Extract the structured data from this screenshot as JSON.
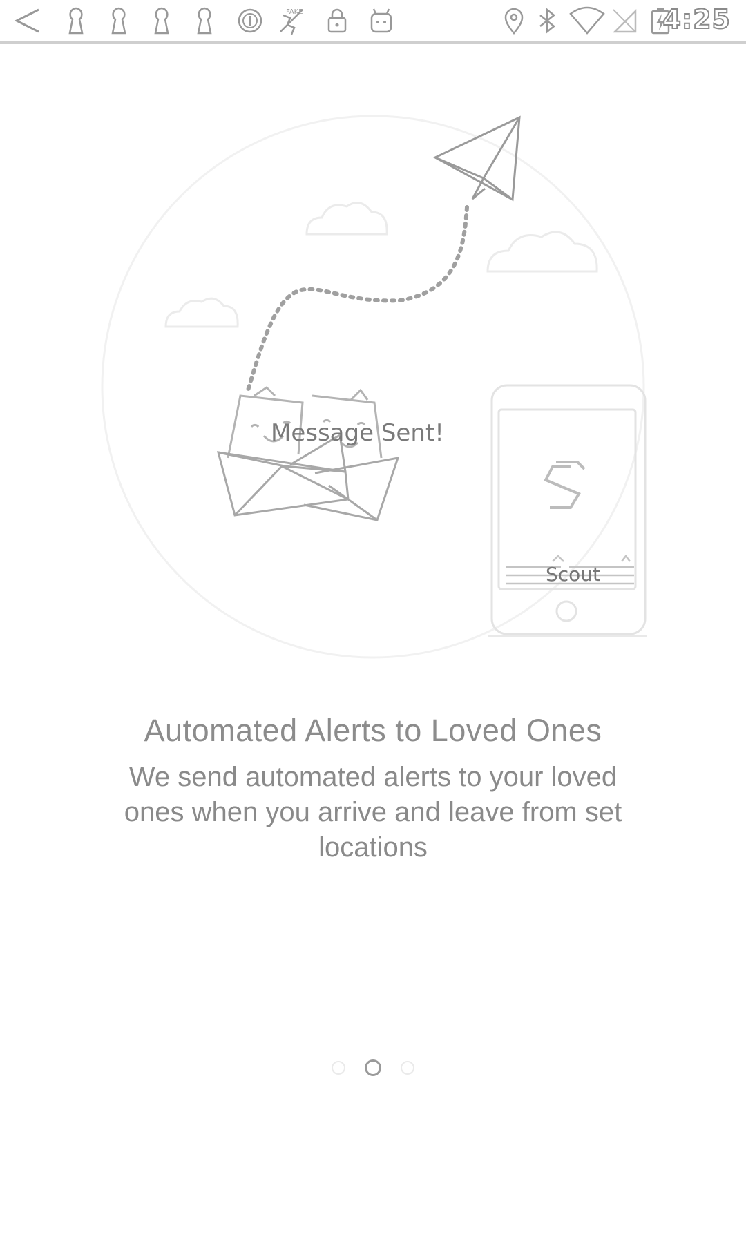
{
  "status_bar": {
    "time": "4:25",
    "left_icons": [
      "back-arrow-icon",
      "keyhole-icon",
      "keyhole-icon",
      "keyhole-icon",
      "keyhole-icon",
      "circle-one-icon",
      "fake-gps-icon",
      "lock-icon",
      "android-robot-icon"
    ],
    "right_icons": [
      "location-pin-icon",
      "bluetooth-icon",
      "wifi-icon",
      "no-signal-icon",
      "battery-charging-icon"
    ]
  },
  "illustration": {
    "message_label": "Message Sent!",
    "phone_app_name": "Scout"
  },
  "onboarding": {
    "title": "Automated Alerts to Loved Ones",
    "description": "We send automated alerts to your loved ones when you arrive and leave from set locations"
  },
  "pager": {
    "pages": 3,
    "current_page": 2
  }
}
